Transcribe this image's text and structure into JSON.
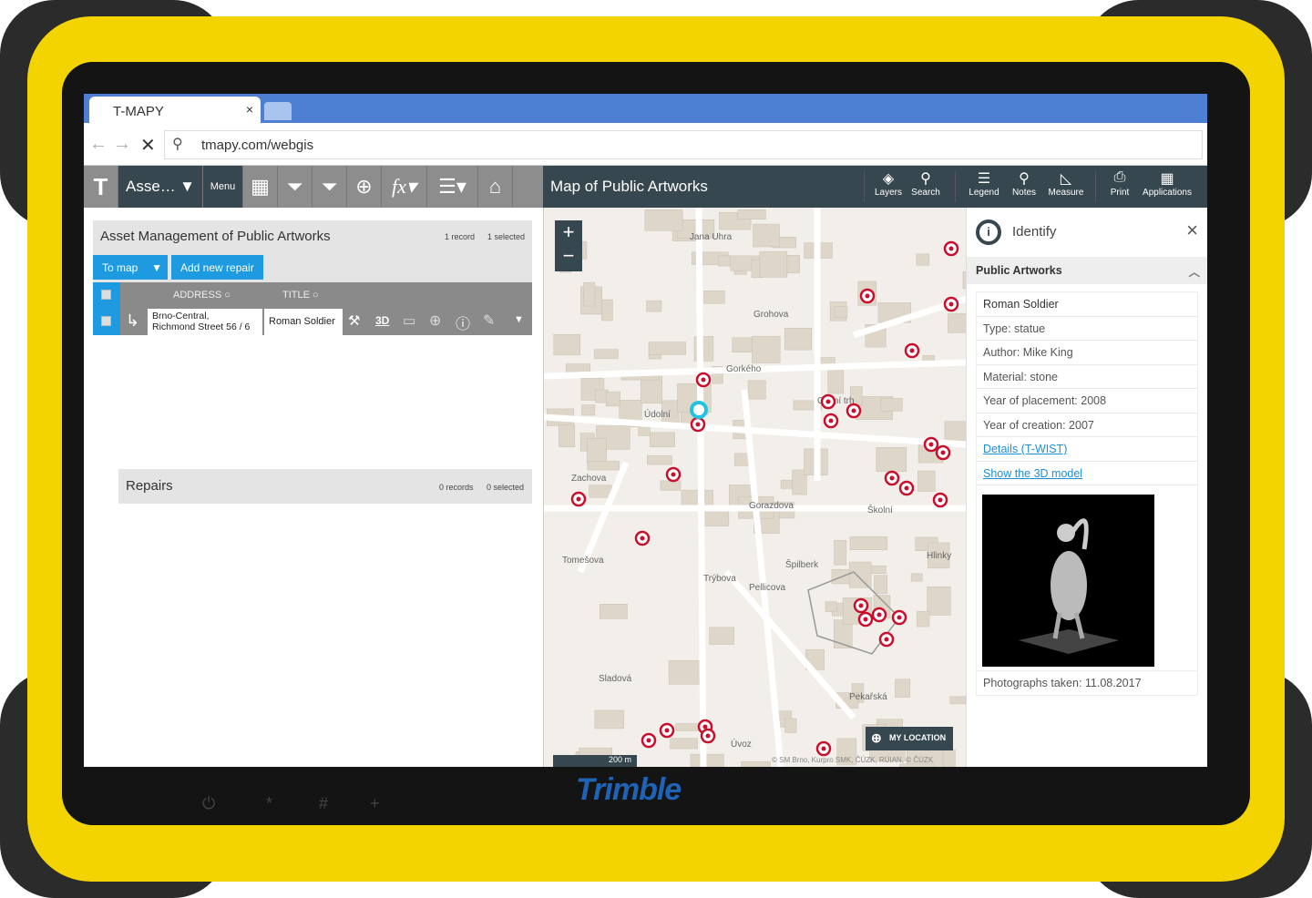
{
  "device": {
    "brand": "Trimble",
    "keys": [
      "⏻",
      "*",
      "#",
      "+"
    ],
    "colors": {
      "body": "#f3d400",
      "bumper": "#2b2b2b"
    }
  },
  "browser": {
    "tab_title": "T-MAPY",
    "tab_close": "×",
    "url": "tmapy.com/webgis",
    "back": "←",
    "forward": "→",
    "stop": "✕"
  },
  "app_toolbar": {
    "app_selector": "Asse…",
    "menu": "Menu",
    "icons": [
      "logo-icon",
      "table-icon",
      "filter-icon",
      "filter-multi-icon",
      "add-icon",
      "function-icon",
      "list-icon",
      "home-icon"
    ]
  },
  "map_header": {
    "title": "Map of Public Artworks",
    "tools": [
      {
        "label": "Layers",
        "icon": "layers-icon"
      },
      {
        "label": "Search",
        "icon": "search-icon"
      },
      {
        "label": "Legend",
        "icon": "legend-icon"
      },
      {
        "label": "Notes",
        "icon": "pin-icon"
      },
      {
        "label": "Measure",
        "icon": "measure-icon"
      },
      {
        "label": "Print",
        "icon": "print-icon"
      },
      {
        "label": "Applications",
        "icon": "apps-icon"
      }
    ]
  },
  "asset_panel": {
    "title": "Asset Management of Public Artworks",
    "records": "1 record",
    "selected": "1 selected",
    "to_map": "To map",
    "add_repair": "Add new repair",
    "columns": [
      "ADDRESS",
      "TITLE"
    ],
    "rows": [
      {
        "address_line1": "Brno-Central,",
        "address_line2": "Richmond Street 56 / 6",
        "title": "Roman Soldier"
      }
    ],
    "row_actions": [
      "3D"
    ]
  },
  "repairs_panel": {
    "title": "Repairs",
    "records": "0 records",
    "selected": "0 selected"
  },
  "map": {
    "zoom_in": "+",
    "zoom_out": "−",
    "my_location": "MY LOCATION",
    "scale": "200 m",
    "attribution": "© SM Brno, Kurpro SMK, ČÚZK, RÚIAN, © ČÚZK",
    "streets": [
      "Jana Uhra",
      "Grohova",
      "Gorkého",
      "Údolní",
      "Obilní trh",
      "Zachova",
      "Tomešova",
      "Gorazdova",
      "Trýbova",
      "Pellicova",
      "Pekařská",
      "Úvoz",
      "Hlinky",
      "Špilberk",
      "Sladová",
      "Školní"
    ]
  },
  "identify": {
    "title": "Identify",
    "close": "×",
    "layer": "Public Artworks",
    "name": "Roman Soldier",
    "attributes": [
      "Type: statue",
      "Author: Mike King",
      "Material: stone",
      "Year of placement: 2008",
      "Year of creation: 2007"
    ],
    "links": [
      "Details (T-WIST)",
      "Show the 3D model"
    ],
    "photo_caption": "Photographs taken: 11.08.2017"
  }
}
